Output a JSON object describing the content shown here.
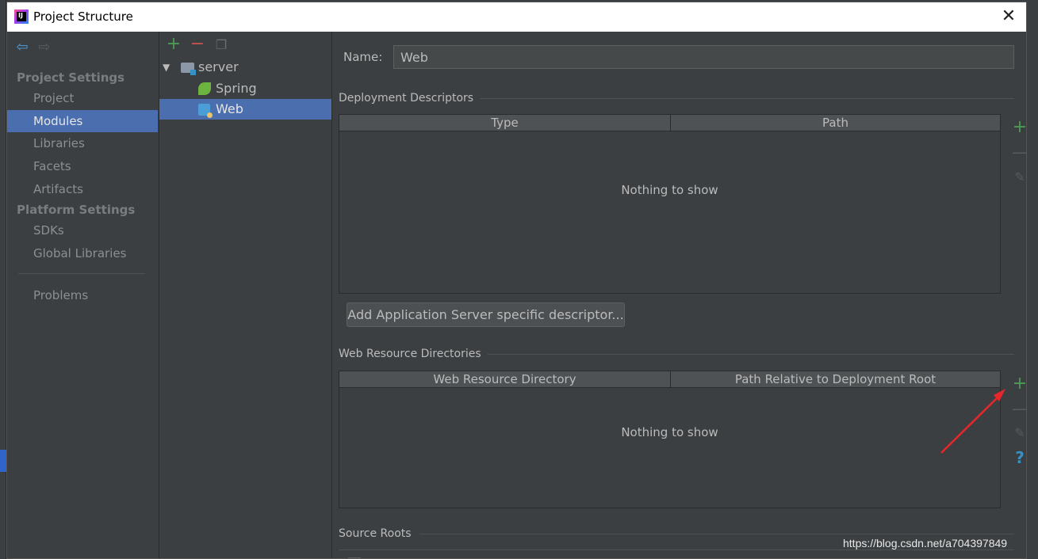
{
  "window": {
    "title": "Project Structure",
    "icon": "intellij-icon"
  },
  "nav": {
    "back_icon": "arrow-left-icon",
    "forward_icon": "arrow-right-icon",
    "project_settings_label": "Project Settings",
    "platform_settings_label": "Platform Settings",
    "items": {
      "project": "Project",
      "modules": "Modules",
      "libraries": "Libraries",
      "facets": "Facets",
      "artifacts": "Artifacts",
      "sdks": "SDKs",
      "global_libraries": "Global Libraries",
      "problems": "Problems"
    },
    "selected": "Modules"
  },
  "tree": {
    "toolbar": {
      "add": "+",
      "remove": "−"
    },
    "root": "server",
    "children": [
      "Spring",
      "Web"
    ],
    "selected": "Web"
  },
  "content": {
    "name_label": "Name:",
    "name_value": "Web",
    "deployment_descriptors": {
      "title": "Deployment Descriptors",
      "columns": [
        "Type",
        "Path"
      ],
      "empty_text": "Nothing to show"
    },
    "add_descriptor_button": "Add Application Server specific descriptor...",
    "web_resource_directories": {
      "title": "Web Resource Directories",
      "columns": [
        "Web Resource Directory",
        "Path Relative to Deployment Root"
      ],
      "empty_text": "Nothing to show"
    },
    "source_roots": {
      "title": "Source Roots"
    },
    "side_tools": {
      "add": "+",
      "remove": "—",
      "help": "?"
    }
  },
  "watermark": "https://blog.csdn.net/a704397849",
  "colors": {
    "background": "#3c3f41",
    "selection": "#4b6eaf",
    "add_green": "#499c54",
    "remove_red": "#c75450",
    "annotation_arrow": "#e8262b"
  }
}
